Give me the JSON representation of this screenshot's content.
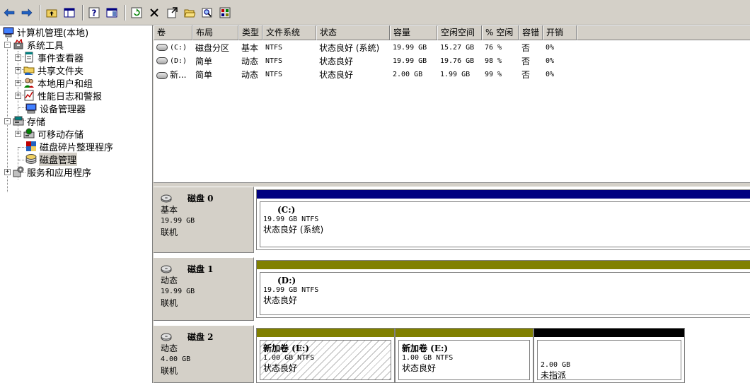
{
  "toolbar": {
    "buttons": [
      {
        "name": "back-arrow-icon"
      },
      {
        "name": "forward-arrow-icon"
      },
      {
        "name": "up-folder-icon"
      },
      {
        "name": "show-hide-tree-icon"
      },
      {
        "name": "help-icon"
      },
      {
        "name": "properties-icon"
      },
      {
        "name": "refresh-icon"
      },
      {
        "name": "delete-icon"
      },
      {
        "name": "export-icon"
      },
      {
        "name": "open-folder-icon"
      },
      {
        "name": "search-icon"
      },
      {
        "name": "settings-icon"
      }
    ]
  },
  "tree": {
    "root": "计算机管理(本地)",
    "system_tools": "系统工具",
    "event_viewer": "事件查看器",
    "shared_folders": "共享文件夹",
    "local_users": "本地用户和组",
    "perf_logs": "性能日志和警报",
    "device_manager": "设备管理器",
    "storage": "存储",
    "removable_storage": "可移动存储",
    "defrag": "磁盘碎片整理程序",
    "disk_mgmt": "磁盘管理",
    "services": "服务和应用程序",
    "expand_plus": "+",
    "expand_minus": "-"
  },
  "volumes": {
    "headers": [
      "卷",
      "布局",
      "类型",
      "文件系统",
      "状态",
      "容量",
      "空闲空间",
      "% 空闲",
      "容错",
      "开销"
    ],
    "rows": [
      {
        "vol": "(C:)",
        "layout": "磁盘分区",
        "type": "基本",
        "fs": "NTFS",
        "status": "状态良好 (系统)",
        "cap": "19.99 GB",
        "free": "15.27 GB",
        "pct": "76 %",
        "ft": "否",
        "ovh": "0%"
      },
      {
        "vol": "(D:)",
        "layout": "简单",
        "type": "动态",
        "fs": "NTFS",
        "status": "状态良好",
        "cap": "19.99 GB",
        "free": "19.76 GB",
        "pct": "98 %",
        "ft": "否",
        "ovh": "0%"
      },
      {
        "vol": "新...",
        "layout": "简单",
        "type": "动态",
        "fs": "NTFS",
        "status": "状态良好",
        "cap": "2.00 GB",
        "free": "1.99 GB",
        "pct": "99 %",
        "ft": "否",
        "ovh": "0%"
      }
    ]
  },
  "disks": [
    {
      "name": "磁盘 0",
      "kind": "基本",
      "size": "19.99 GB",
      "state": "联机",
      "partitions": [
        {
          "title": "(C:)",
          "detail": "19.99 GB NTFS",
          "status": "状态良好 (系统)",
          "bar_color": "#000080"
        }
      ]
    },
    {
      "name": "磁盘 1",
      "kind": "动态",
      "size": "19.99 GB",
      "state": "联机",
      "partitions": [
        {
          "title": "(D:)",
          "detail": "19.99 GB NTFS",
          "status": "状态良好",
          "bar_color": "#808000"
        }
      ]
    },
    {
      "name": "磁盘 2",
      "kind": "动态",
      "size": "4.00 GB",
      "state": "联机",
      "partitions": [
        {
          "title": "新加卷   (E:)",
          "detail": "1.00 GB NTFS",
          "status": "状态良好",
          "bar_color": "#808000"
        },
        {
          "title": "新加卷   (E:)",
          "detail": "1.00 GB NTFS",
          "status": "状态良好",
          "bar_color": "#808000"
        },
        {
          "title": "",
          "detail": "2.00 GB",
          "status": "未指派",
          "bar_color": "#000000"
        }
      ]
    }
  ]
}
